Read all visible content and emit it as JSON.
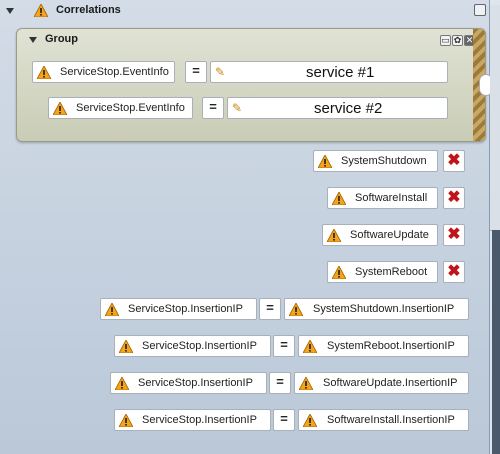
{
  "panel": {
    "title": "Correlations",
    "collapse_icon": "chevron-down-icon",
    "header_icon": "window-icon"
  },
  "group": {
    "title": "Group",
    "buttons": [
      "restore-icon",
      "settings-icon",
      "close-icon"
    ],
    "rows": [
      {
        "field": "ServiceStop.EventInfo",
        "operator": "=",
        "value": "service #1"
      },
      {
        "field": "ServiceStop.EventInfo",
        "operator": "=",
        "value": "service #2"
      }
    ]
  },
  "events": [
    {
      "label": "SystemShutdown"
    },
    {
      "label": "SoftwareInstall"
    },
    {
      "label": "SoftwareUpdate"
    },
    {
      "label": "SystemReboot"
    }
  ],
  "correlations": [
    {
      "left": "ServiceStop.InsertionIP",
      "operator": "=",
      "right": "SystemShutdown.InsertionIP"
    },
    {
      "left": "ServiceStop.InsertionIP",
      "operator": "=",
      "right": "SystemReboot.InsertionIP"
    },
    {
      "left": "ServiceStop.InsertionIP",
      "operator": "=",
      "right": "SoftwareUpdate.InsertionIP"
    },
    {
      "left": "ServiceStop.InsertionIP",
      "operator": "=",
      "right": "SoftwareInstall.InsertionIP"
    }
  ],
  "colors": {
    "warning": "#f5a31a",
    "delete": "#c0141a",
    "panel_bg": "#c9d4e0",
    "group_bg": "#d6d9c6"
  }
}
